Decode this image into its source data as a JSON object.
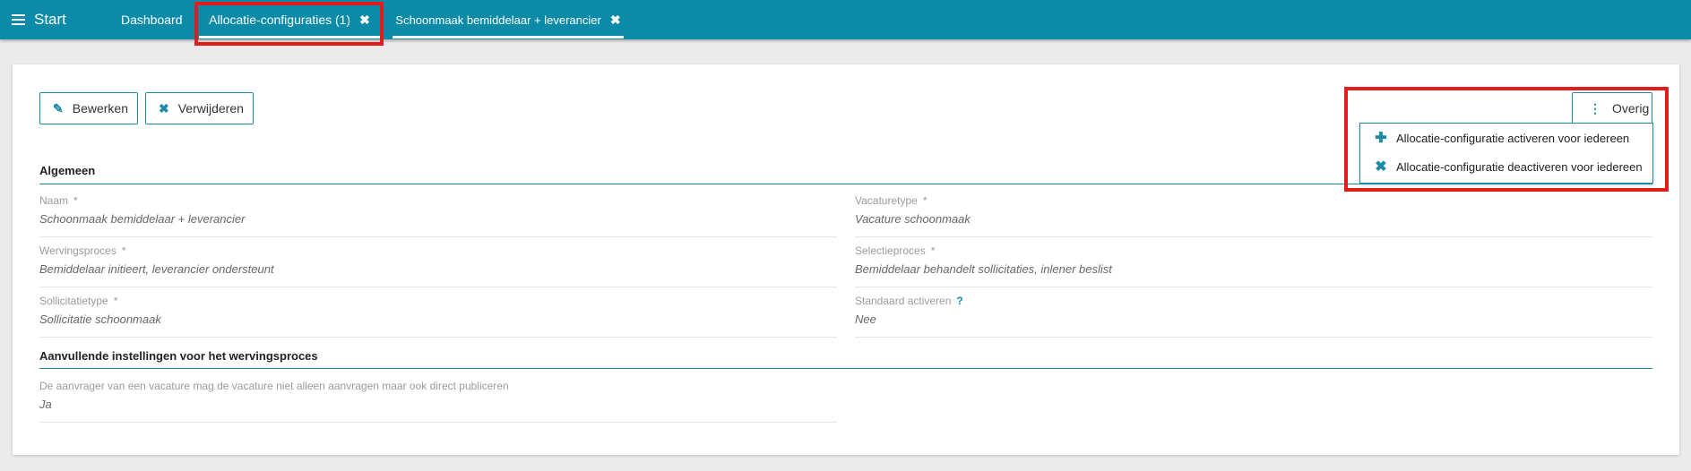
{
  "topbar": {
    "start_label": "Start",
    "tabs": [
      {
        "label": "Dashboard"
      },
      {
        "label": "Allocatie-configuraties (1)",
        "close": "✖"
      },
      {
        "label": "Schoonmaak bemiddelaar + leverancier",
        "close": "✖"
      }
    ]
  },
  "toolbar": {
    "edit_label": "Bewerken",
    "delete_label": "Verwijderen",
    "more_label": "Overig"
  },
  "menu": {
    "items": [
      {
        "label": "Allocatie-configuratie activeren voor iedereen"
      },
      {
        "label": "Allocatie-configuratie deactiveren voor iedereen"
      }
    ]
  },
  "sections": {
    "general_title": "Algemeen",
    "extra_title": "Aanvullende instellingen voor het wervingsproces"
  },
  "fields": {
    "naam": {
      "label": "Naam",
      "req": "*",
      "value": "Schoonmaak bemiddelaar + leverancier"
    },
    "vacaturetype": {
      "label": "Vacaturetype",
      "req": "*",
      "value": "Vacature schoonmaak"
    },
    "wervingsproces": {
      "label": "Wervingsproces",
      "req": "*",
      "value": "Bemiddelaar initieert, leverancier ondersteunt"
    },
    "selectieproces": {
      "label": "Selectieproces",
      "req": "*",
      "value": "Bemiddelaar behandelt sollicitaties, inlener beslist"
    },
    "sollicitatietype": {
      "label": "Sollicitatietype",
      "req": "*",
      "value": "Sollicitatie schoonmaak"
    },
    "standaard": {
      "label": "Standaard activeren",
      "help": "?",
      "value": "Nee"
    },
    "aanvrager": {
      "label": "De aanvrager van een vacature mag de vacature niet alleen aanvragen maar ook direct publiceren",
      "value": "Ja"
    }
  },
  "colors": {
    "topbar": "#0b8ba8",
    "accent": "#1a8aa5",
    "highlight": "#e01c1c"
  }
}
